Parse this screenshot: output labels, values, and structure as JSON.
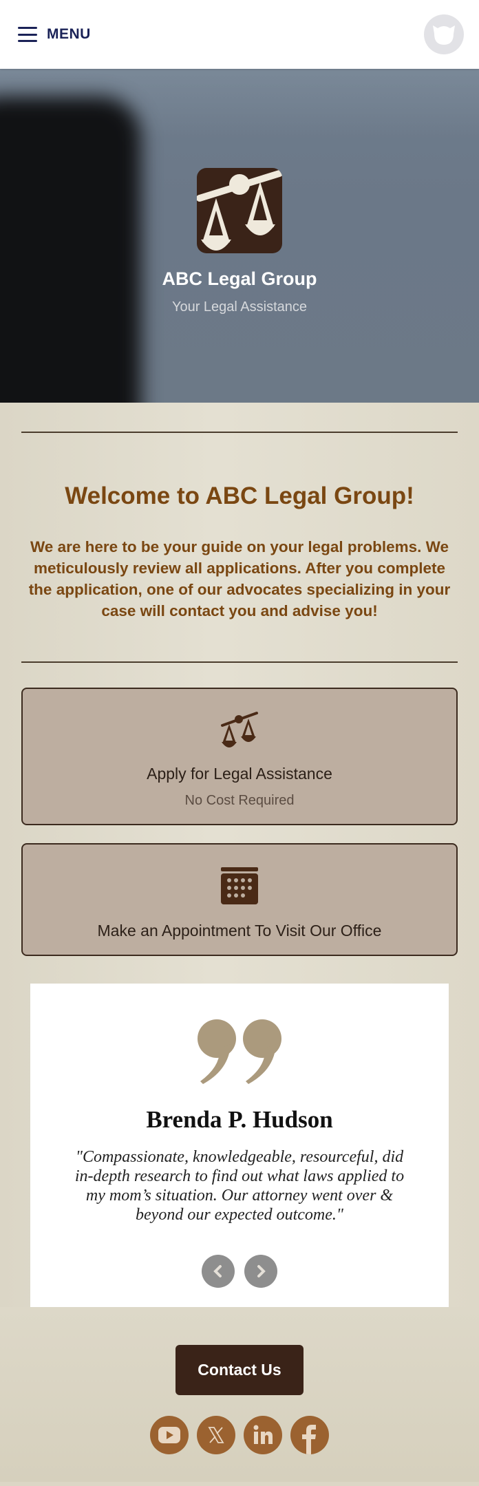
{
  "header": {
    "menu_label": "MENU",
    "menu_icon": "hamburger-icon",
    "avatar_icon": "user-avatar-icon"
  },
  "hero": {
    "logo_icon": "scales-of-justice-icon",
    "title": "ABC Legal Group",
    "subtitle": "Your Legal Assistance"
  },
  "welcome": {
    "title": "Welcome to ABC Legal Group!",
    "body": "We are here to be your guide on your legal problems. We meticulously review all applications. After you complete the application, one of our advocates specializing in your case will contact you and advise you!"
  },
  "cards": [
    {
      "icon": "scales-icon",
      "title": "Apply for Legal Assistance",
      "subtitle": "No Cost Required"
    },
    {
      "icon": "calendar-icon",
      "title": "Make an Appointment To Visit Our Office"
    }
  ],
  "testimonial": {
    "quote_icon": "quote-icon",
    "name": "Brenda P. Hudson",
    "text": "\"Compassionate, knowledgeable, resourceful, did in-depth research to find out what laws applied to my mom’s situation. Our attorney went over & beyond our expected outcome.\"",
    "prev_icon": "chevron-left-icon",
    "next_icon": "chevron-right-icon"
  },
  "footer": {
    "contact_label": "Contact Us",
    "socials": [
      {
        "name": "YouTube",
        "icon": "youtube-icon"
      },
      {
        "name": "X",
        "icon": "x-icon"
      },
      {
        "name": "LinkedIn",
        "icon": "linkedin-icon"
      },
      {
        "name": "Facebook",
        "icon": "facebook-icon"
      }
    ]
  },
  "colors": {
    "accent_brown": "#7a4712",
    "dark_brown": "#3a2318",
    "card_bg": "#bdaea0",
    "social_bg": "#9b6230",
    "quote_tan": "#ab9a7d",
    "menu_navy": "#1a2257"
  }
}
